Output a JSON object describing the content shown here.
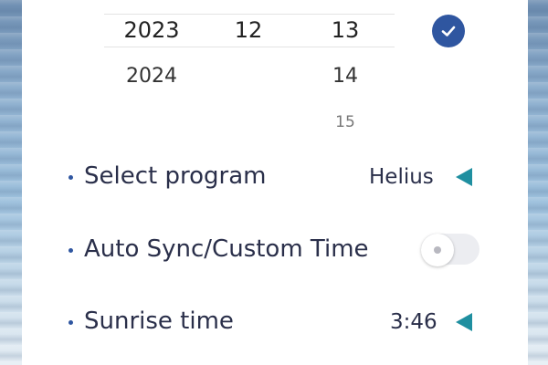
{
  "date_picker": {
    "selected": {
      "year": "2023",
      "month": "12",
      "day": "13"
    },
    "next": {
      "year": "2024",
      "day": "14"
    },
    "next2": {
      "day": "15"
    }
  },
  "confirm_icon": "check-circle-icon",
  "settings": [
    {
      "label": "Select program",
      "value": "Helius",
      "control": "dropdown-arrow-icon"
    },
    {
      "label": "Auto Sync/Custom Time",
      "value": "",
      "control": "toggle",
      "toggle_on": false
    },
    {
      "label": "Sunrise time",
      "value": "3:46",
      "control": "dropdown-arrow-icon"
    }
  ],
  "colors": {
    "accent": "#2f56a0",
    "arrow": "#1f8fa0",
    "text": "#2a2f4a"
  }
}
